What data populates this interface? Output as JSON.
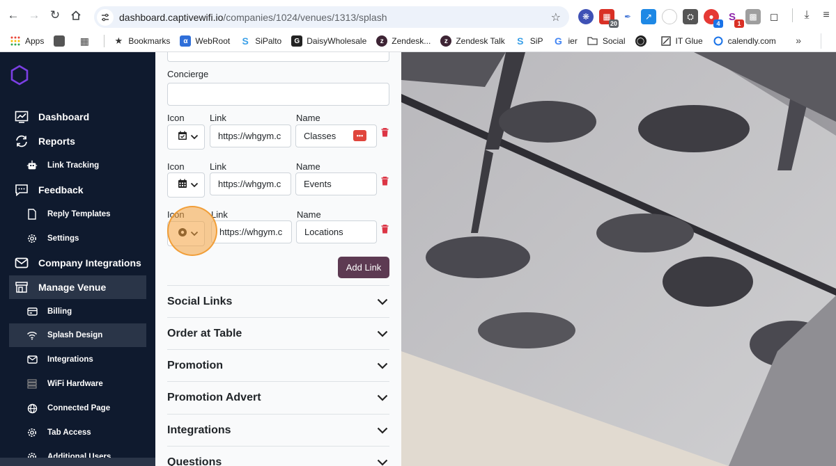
{
  "browser": {
    "url_host": "dashboard.captivewifi.io",
    "url_path": "/companies/1024/venues/1313/splash",
    "extension_badges": [
      "20",
      "4",
      "1"
    ],
    "bookmarks": [
      {
        "label": "Apps",
        "icon": "apps-grid-icon",
        "color": "#ea4335"
      },
      {
        "label": "Bookmarks",
        "icon": "star-icon",
        "color": "#333333"
      },
      {
        "label": "WebRoot",
        "icon": "webroot-icon",
        "color": "#2f6fd9"
      },
      {
        "label": "SiPalto",
        "icon": "sipalto-icon",
        "color": "#3aa0e8"
      },
      {
        "label": "DaisyWholesale",
        "icon": "daisy-icon",
        "color": "#222222"
      },
      {
        "label": "Zendesk...",
        "icon": "zendesk-icon",
        "color": "#3d2434"
      },
      {
        "label": "Zendesk Talk",
        "icon": "zendesk-talk-icon",
        "color": "#3d2434"
      },
      {
        "label": "SiP",
        "icon": "sip-icon",
        "color": "#3aa0e8"
      },
      {
        "label": "ier",
        "icon": "google-icon",
        "color": "#4285f4"
      },
      {
        "label": "Social",
        "icon": "folder-icon",
        "color": "#444444"
      },
      {
        "label": "",
        "icon": "globe-icon",
        "color": "#222222"
      },
      {
        "label": "IT Glue",
        "icon": "itglue-icon",
        "color": "#333333"
      },
      {
        "label": "calendly.com",
        "icon": "calendly-icon",
        "color": "#1a73e8"
      }
    ]
  },
  "sidebar": {
    "items": [
      {
        "label": "Dashboard",
        "icon": "dashboard-icon",
        "level": "top"
      },
      {
        "label": "Reports",
        "icon": "reports-sync-icon",
        "level": "top"
      },
      {
        "label": "Link Tracking",
        "icon": "link-tracking-icon",
        "level": "sub"
      },
      {
        "label": "Feedback",
        "icon": "feedback-chat-icon",
        "level": "top"
      },
      {
        "label": "Reply Templates",
        "icon": "document-icon",
        "level": "sub"
      },
      {
        "label": "Settings",
        "icon": "gear-icon",
        "level": "sub"
      },
      {
        "label": "Company Integrations",
        "icon": "envelope-icon",
        "level": "top"
      },
      {
        "label": "Manage Venue",
        "icon": "storefront-icon",
        "level": "top",
        "active": true
      },
      {
        "label": "Billing",
        "icon": "billing-icon",
        "level": "sub"
      },
      {
        "label": "Splash Design",
        "icon": "wifi-icon",
        "level": "sub",
        "active": true
      },
      {
        "label": "Integrations",
        "icon": "envelope-icon",
        "level": "sub"
      },
      {
        "label": "WiFi Hardware",
        "icon": "hardware-icon",
        "level": "sub"
      },
      {
        "label": "Connected Page",
        "icon": "globe-icon",
        "level": "sub"
      },
      {
        "label": "Tab Access",
        "icon": "gear-icon",
        "level": "sub"
      },
      {
        "label": "Additional Users",
        "icon": "gear-icon",
        "level": "sub"
      }
    ]
  },
  "form": {
    "concierge_label": "Concierge",
    "concierge_value": "",
    "link_rows": [
      {
        "icon_label": "Icon",
        "link_label": "Link",
        "name_label": "Name",
        "icon": "calendar-check-icon",
        "link": "https://whgym.c",
        "name": "Classes"
      },
      {
        "icon_label": "Icon",
        "link_label": "Link",
        "name_label": "Name",
        "icon": "calendar-icon",
        "link": "https://whgym.c",
        "name": "Events"
      },
      {
        "icon_label": "Icon",
        "link_label": "Link",
        "name_label": "Name",
        "icon": "location-dot-icon",
        "link": "https://whgym.c",
        "name": "Locations"
      }
    ],
    "add_link_label": "Add Link",
    "sections": [
      "Social Links",
      "Order at Table",
      "Promotion",
      "Promotion Advert",
      "Integrations",
      "Questions"
    ]
  },
  "colors": {
    "sidebar_bg": "#0f1a2e",
    "sidebar_active": "#2a3548",
    "accent_button": "#5d3a52",
    "delete_red": "#dc3545",
    "logo_purple": "#7b3fe4"
  }
}
